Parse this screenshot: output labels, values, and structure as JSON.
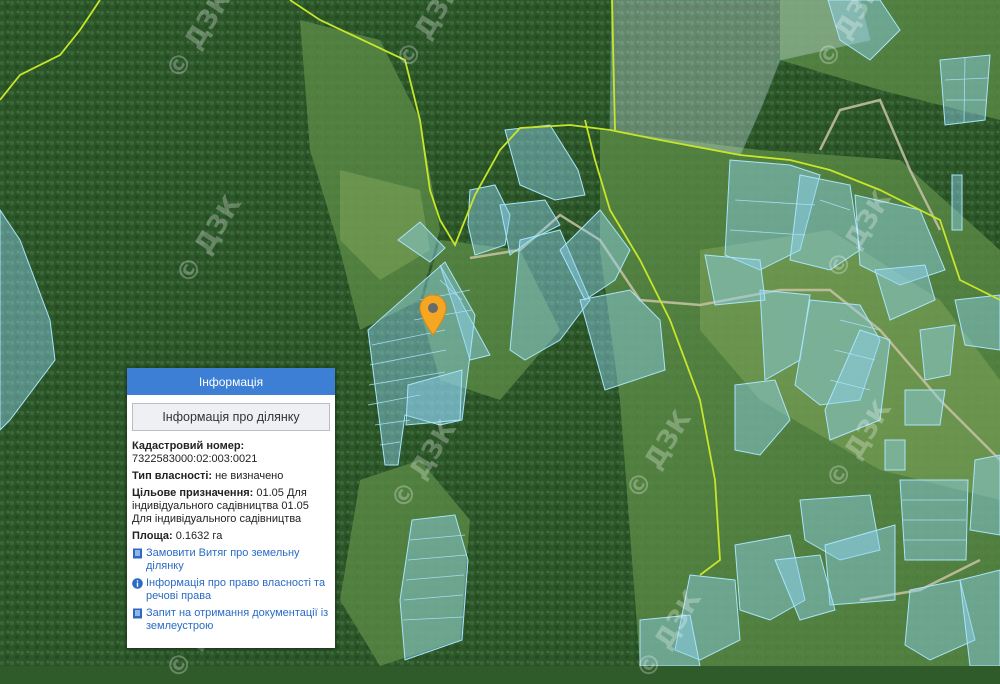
{
  "map": {
    "watermark": "© ДЗК",
    "marker_icon": "location-pin-icon",
    "colors": {
      "parcel_fill": "#8fd3ef",
      "parcel_stroke": "#a9e4fb",
      "boundary_line": "#c7e62a",
      "marker": "#f5a623"
    }
  },
  "panel": {
    "title": "Інформація",
    "subtitle": "Інформація про ділянку",
    "cadastral_label": "Кадастровий номер:",
    "cadastral_value": "7322583000:02:003:0021",
    "ownership_label": "Тип власності:",
    "ownership_value": " не визначено",
    "purpose_label": "Цільове призначення:",
    "purpose_value": " 01.05 Для індивідуального садівництва 01.05 Для індивідуального садівництва",
    "area_label": "Площа:",
    "area_value": " 0.1632 га",
    "links": [
      {
        "text": "Замовити Витяг про земельну ділянку",
        "icon": "document-icon"
      },
      {
        "text": "Інформація про право власності та речові права",
        "icon": "info-icon"
      },
      {
        "text": "Запит на отримання документації із землеустрою",
        "icon": "document-icon"
      }
    ],
    "accent_color": "#3d7fd4"
  }
}
